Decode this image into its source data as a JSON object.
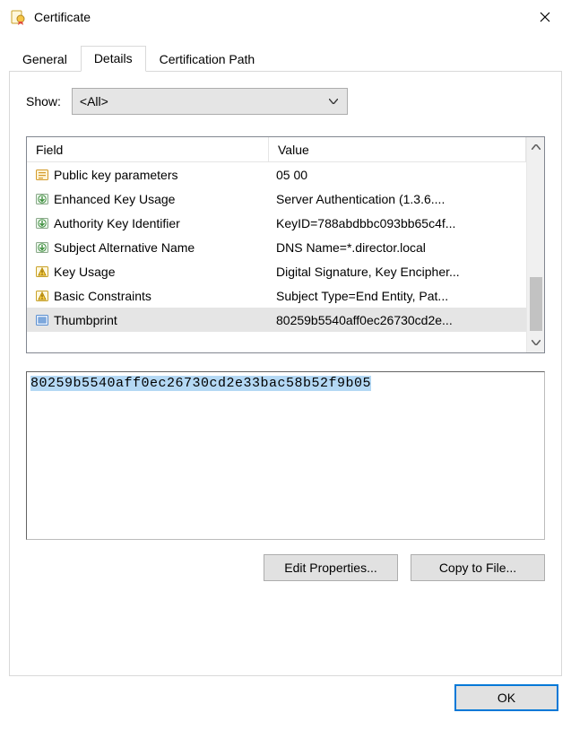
{
  "window": {
    "title": "Certificate",
    "close_icon": "close-icon"
  },
  "tabs": [
    {
      "label": "General",
      "active": false
    },
    {
      "label": "Details",
      "active": true
    },
    {
      "label": "Certification Path",
      "active": false
    }
  ],
  "show": {
    "label": "Show:",
    "selected": "<All>"
  },
  "list": {
    "headers": {
      "field": "Field",
      "value": "Value"
    },
    "rows": [
      {
        "icon": "ext-prop-icon",
        "field": "Public key parameters",
        "value": "05 00",
        "selected": false
      },
      {
        "icon": "ext-arrow-icon",
        "field": "Enhanced Key Usage",
        "value": "Server Authentication (1.3.6....",
        "selected": false
      },
      {
        "icon": "ext-arrow-icon",
        "field": "Authority Key Identifier",
        "value": "KeyID=788abdbbc093bb65c4f...",
        "selected": false
      },
      {
        "icon": "ext-arrow-icon",
        "field": "Subject Alternative Name",
        "value": "DNS Name=*.director.local",
        "selected": false
      },
      {
        "icon": "ext-warn-icon",
        "field": "Key Usage",
        "value": "Digital Signature, Key Encipher...",
        "selected": false
      },
      {
        "icon": "ext-warn-icon",
        "field": "Basic Constraints",
        "value": "Subject Type=End Entity, Pat...",
        "selected": false
      },
      {
        "icon": "thumbprint-icon",
        "field": "Thumbprint",
        "value": "80259b5540aff0ec26730cd2e...",
        "selected": true
      }
    ]
  },
  "detail": {
    "value": "80259b5540aff0ec26730cd2e33bac58b52f9b05"
  },
  "buttons": {
    "edit_properties": "Edit Properties...",
    "copy_to_file": "Copy to File...",
    "ok": "OK"
  }
}
